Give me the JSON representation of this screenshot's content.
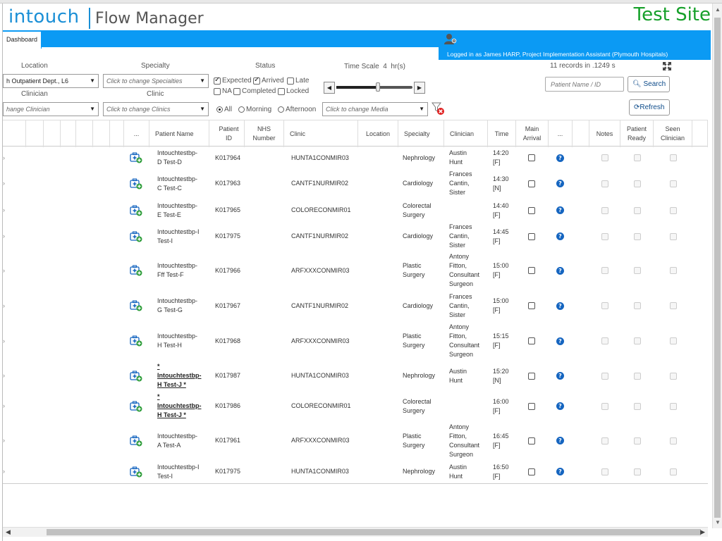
{
  "header": {
    "logo": "intouch",
    "product": "Flow Manager",
    "site_label": "Test Site"
  },
  "nav": {
    "tab_dashboard": "Dashboard",
    "user_info": "Logged in as James HARP, Project Implementation Assistant (Plymouth Hospitals)"
  },
  "filters": {
    "location_label": "Location",
    "location_value": "h Outpatient Dept., L6",
    "specialty_label": "Specialty",
    "specialty_value": "Click to change Specialties",
    "status_label": "Status",
    "clinician_label": "Clinician",
    "clinician_value": "hange Clinician",
    "clinic_label": "Clinic",
    "clinic_value": "Click to change Clinics",
    "status_checks": [
      {
        "label": "Expected",
        "checked": true
      },
      {
        "label": "Arrived",
        "checked": true
      },
      {
        "label": "Late",
        "checked": false
      },
      {
        "label": "NA",
        "checked": false
      },
      {
        "label": "Completed",
        "checked": false
      },
      {
        "label": "Locked",
        "checked": false
      }
    ],
    "time_scale_label": "Time Scale",
    "time_scale_value": "4",
    "time_scale_unit": "hr(s)",
    "time_scale_fraction": 0.55,
    "radios": [
      {
        "label": "All",
        "checked": true
      },
      {
        "label": "Morning",
        "checked": false
      },
      {
        "label": "Afternoon",
        "checked": false
      }
    ],
    "media_value": "Click to change Media"
  },
  "search": {
    "records_text": "11 records in .1249 s",
    "placeholder": "Patient Name / ID",
    "search_label": "Search",
    "refresh_label": "Refresh"
  },
  "grid": {
    "columns": [
      "...",
      "Patient Name",
      "Patient ID",
      "NHS Number",
      "Clinic",
      "Location",
      "Specialty",
      "Clinician",
      "Time",
      "Main Arrival",
      "...",
      "Notes",
      "Patient Ready",
      "Seen Clinician"
    ],
    "rows": [
      {
        "name1": "Intouchtestbp-",
        "name2": "D Test-D",
        "star": "",
        "bold": false,
        "pid": "K017964",
        "clinic": "HUNTA1CONMIR03",
        "specialty": [
          "Nephrology"
        ],
        "clinician": [
          "Austin",
          "Hunt"
        ],
        "time": "14:20",
        "flag": "[F]"
      },
      {
        "name1": "Intouchtestbp-",
        "name2": "C Test-C",
        "star": "",
        "bold": false,
        "pid": "K017963",
        "clinic": "CANTF1NURMIR02",
        "specialty": [
          "Cardiology"
        ],
        "clinician": [
          "Frances",
          "Cantin,",
          "Sister"
        ],
        "time": "14:30",
        "flag": "[N]"
      },
      {
        "name1": "Intouchtestbp-",
        "name2": "E Test-E",
        "star": "",
        "bold": false,
        "pid": "K017965",
        "clinic": "COLORECONMIR01",
        "specialty": [
          "Colorectal",
          "Surgery"
        ],
        "clinician": [],
        "time": "14:40",
        "flag": "[F]"
      },
      {
        "name1": "Intouchtestbp-I",
        "name2": "Test-I",
        "star": "",
        "bold": false,
        "pid": "K017975",
        "clinic": "CANTF1NURMIR02",
        "specialty": [
          "Cardiology"
        ],
        "clinician": [
          "Frances",
          "Cantin,",
          "Sister"
        ],
        "time": "14:45",
        "flag": "[F]"
      },
      {
        "name1": "Intouchtestbp-",
        "name2": "Fff Test-F",
        "star": "",
        "bold": false,
        "pid": "K017966",
        "clinic": "ARFXXXCONMIR03",
        "specialty": [
          "Plastic",
          "Surgery"
        ],
        "clinician": [
          "Antony",
          "Fitton,",
          "Consultant",
          "Surgeon"
        ],
        "time": "15:00",
        "flag": "[F]"
      },
      {
        "name1": "Intouchtestbp-",
        "name2": "G Test-G",
        "star": "",
        "bold": false,
        "pid": "K017967",
        "clinic": "CANTF1NURMIR02",
        "specialty": [
          "Cardiology"
        ],
        "clinician": [
          "Frances",
          "Cantin,",
          "Sister"
        ],
        "time": "15:00",
        "flag": "[F]"
      },
      {
        "name1": "Intouchtestbp-",
        "name2": "H Test-H",
        "star": "",
        "bold": false,
        "pid": "K017968",
        "clinic": "ARFXXXCONMIR03",
        "specialty": [
          "Plastic",
          "Surgery"
        ],
        "clinician": [
          "Antony",
          "Fitton,",
          "Consultant",
          "Surgeon"
        ],
        "time": "15:15",
        "flag": "[F]"
      },
      {
        "name1": "Intouchtestbp-",
        "name2": "H Test-J *",
        "star": "*",
        "bold": true,
        "pid": "K017987",
        "clinic": "HUNTA1CONMIR03",
        "specialty": [
          "Nephrology"
        ],
        "clinician": [
          "Austin",
          "Hunt"
        ],
        "time": "15:20",
        "flag": "[N]"
      },
      {
        "name1": "Intouchtestbp-",
        "name2": "H Test-J *",
        "star": "*",
        "bold": true,
        "pid": "K017986",
        "clinic": "COLORECONMIR01",
        "specialty": [
          "Colorectal",
          "Surgery"
        ],
        "clinician": [],
        "time": "16:00",
        "flag": "[F]"
      },
      {
        "name1": "Intouchtestbp-",
        "name2": "A Test-A",
        "star": "",
        "bold": false,
        "pid": "K017961",
        "clinic": "ARFXXXCONMIR03",
        "specialty": [
          "Plastic",
          "Surgery"
        ],
        "clinician": [
          "Antony",
          "Fitton,",
          "Consultant",
          "Surgeon"
        ],
        "time": "16:45",
        "flag": "[F]"
      },
      {
        "name1": "Intouchtestbp-I",
        "name2": "Test-I",
        "star": "",
        "bold": false,
        "pid": "K017975",
        "clinic": "HUNTA1CONMIR03",
        "specialty": [
          "Nephrology"
        ],
        "clinician": [
          "Austin",
          "Hunt"
        ],
        "time": "16:50",
        "flag": "[F]"
      }
    ]
  },
  "colors": {
    "brand_blue": "#0b9af4",
    "logo_blue": "#1a8fd6",
    "test_site_green": "#16a02a",
    "help_icon_blue": "#1565c0",
    "case_icon_green": "#2e9d3a",
    "filter_clear_red": "#e02020"
  },
  "icons": {
    "user_settings": "user-gear-icon",
    "expand": "expand-arrows-icon",
    "filter_clear": "filter-clear-icon",
    "search": "search-icon",
    "refresh": "refresh-icon",
    "case_add": "medical-case-add-icon",
    "help": "question-circle-icon"
  }
}
